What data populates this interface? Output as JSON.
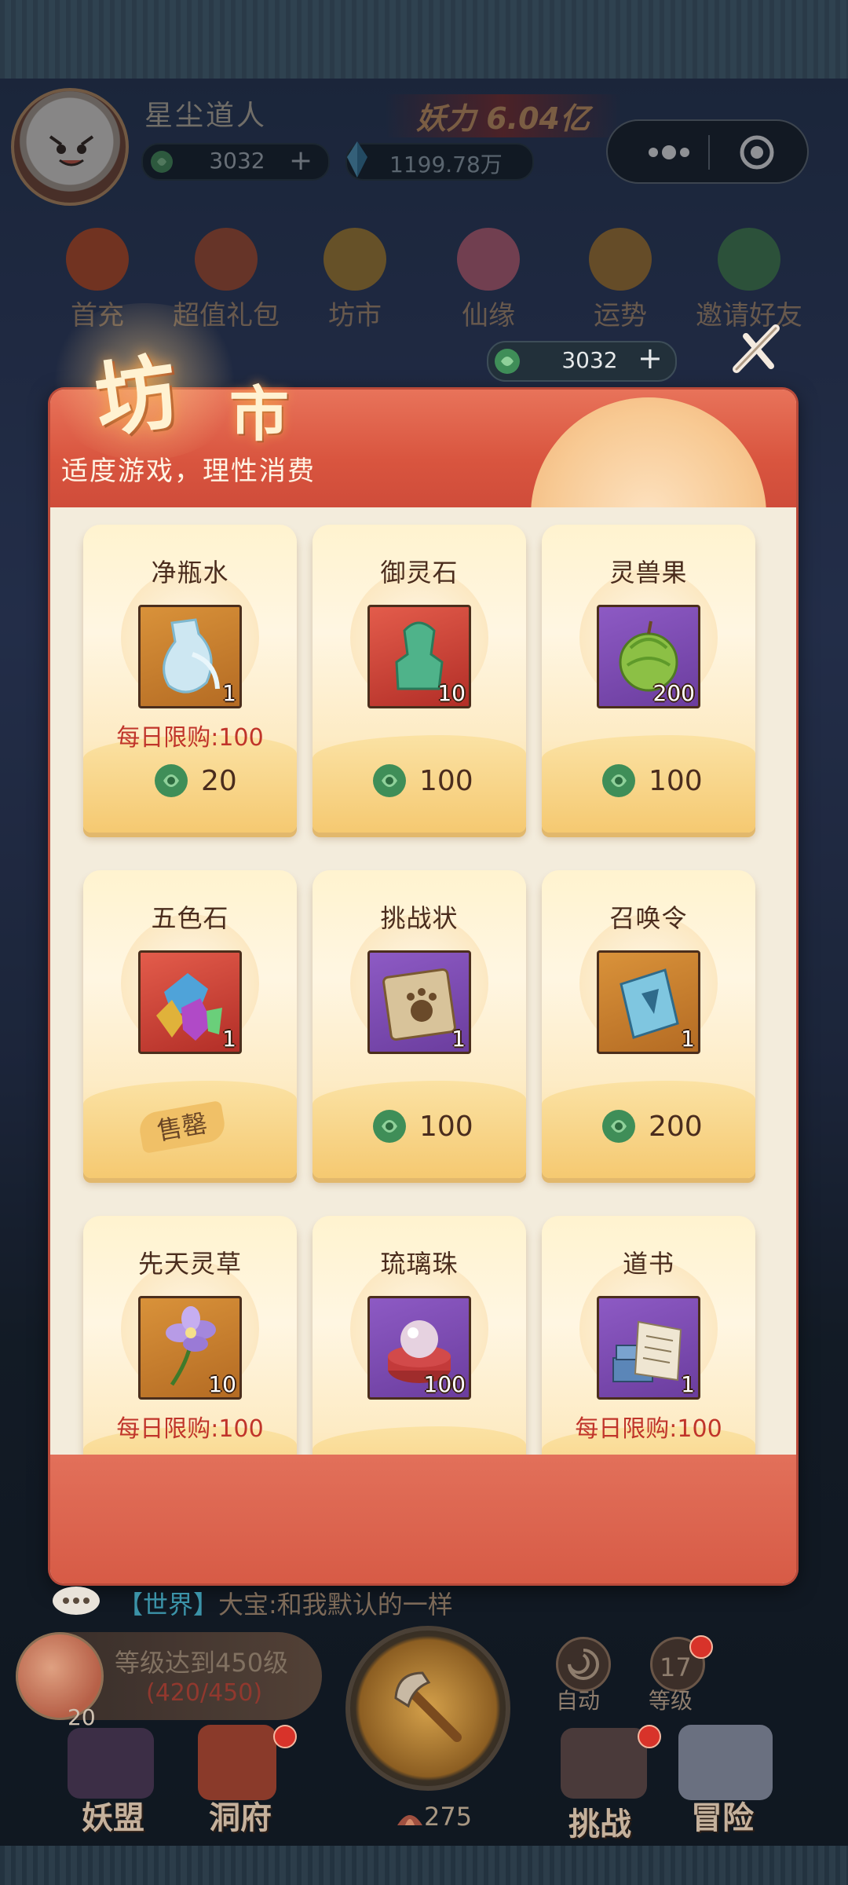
{
  "hud": {
    "player_name": "星尘道人",
    "power": "妖力 6.04亿",
    "jade_balance": "3032",
    "crystal_balance": "1199.78万",
    "plus": "+"
  },
  "top_nav": [
    {
      "label": "首充",
      "icon": "gourd-icon",
      "color": "#c9552d"
    },
    {
      "label": "超值礼包",
      "icon": "gift-bag-icon",
      "color": "#b5573a"
    },
    {
      "label": "坊市",
      "icon": "coin-icon",
      "color": "#b58a3a"
    },
    {
      "label": "仙缘",
      "icon": "lotus-icon",
      "color": "#c86a82"
    },
    {
      "label": "运势",
      "icon": "fortune-sticks-icon",
      "color": "#b3823a"
    },
    {
      "label": "邀请好友",
      "icon": "book-icon",
      "color": "#4b8a5a"
    }
  ],
  "modal": {
    "title_char1": "坊",
    "title_char2": "市",
    "slogan": "适度游戏，理性消费",
    "jade_balance": "3032",
    "plus": "+"
  },
  "items": [
    {
      "name": "净瓶水",
      "qty": "1",
      "limit": "每日限购:100",
      "price": "20",
      "tile": "t-orange",
      "icon": "water-jar-icon"
    },
    {
      "name": "御灵石",
      "qty": "10",
      "limit": "",
      "price": "100",
      "tile": "t-red",
      "icon": "jade-seal-icon"
    },
    {
      "name": "灵兽果",
      "qty": "200",
      "limit": "",
      "price": "100",
      "tile": "t-purple",
      "icon": "green-fruit-icon"
    },
    {
      "name": "五色石",
      "qty": "1",
      "limit": "",
      "price": "",
      "soldout": "售罄",
      "tile": "t-red",
      "icon": "crystal-stones-icon"
    },
    {
      "name": "挑战状",
      "qty": "1",
      "limit": "",
      "price": "100",
      "tile": "t-purple",
      "icon": "challenge-scroll-icon"
    },
    {
      "name": "召唤令",
      "qty": "1",
      "limit": "",
      "price": "200",
      "tile": "t-orange",
      "icon": "summon-token-icon"
    },
    {
      "name": "先天灵草",
      "qty": "10",
      "limit": "每日限购:100",
      "price": "",
      "tile": "t-orange",
      "icon": "flower-icon"
    },
    {
      "name": "琉璃珠",
      "qty": "100",
      "limit": "",
      "price": "",
      "tile": "t-purple",
      "icon": "pearl-icon"
    },
    {
      "name": "道书",
      "qty": "1",
      "limit": "每日限购:100",
      "price": "",
      "tile": "t-purple",
      "icon": "books-icon"
    }
  ],
  "chat": {
    "channel": "【世界】",
    "message": "大宝:和我默认的一样"
  },
  "quest": {
    "title": "等级达到450级",
    "progress": "(420/450)",
    "count": "20"
  },
  "actions": {
    "auto": "自动",
    "level_value": "17",
    "level_label": "等级",
    "axe_count": "275"
  },
  "bottom_nav": {
    "alliance": "妖盟",
    "cave": "洞府",
    "challenge": "挑战",
    "adventure": "冒险"
  },
  "colors": {
    "modal_header": "#d9553f",
    "price_text": "#4a2c1d",
    "limit_text": "#c0342a",
    "chat_channel": "#3b93a8"
  }
}
